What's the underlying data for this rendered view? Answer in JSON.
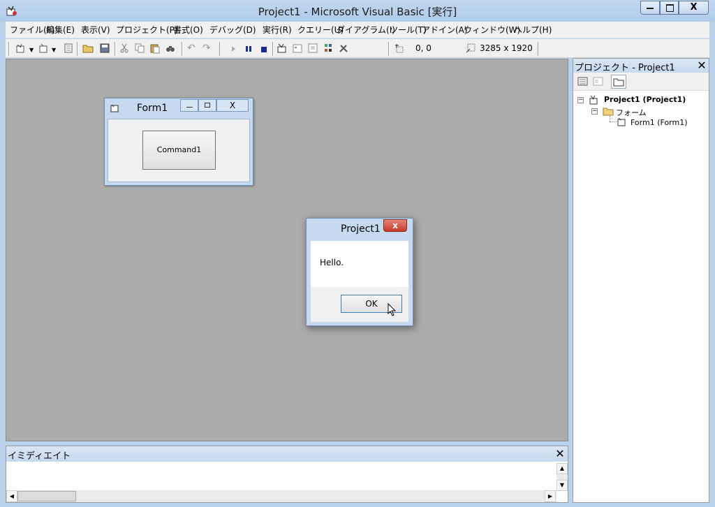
{
  "window": {
    "title": "Project1 - Microsoft Visual Basic [実行]",
    "minimize": "—",
    "maximize": "□",
    "close": "X"
  },
  "menu": [
    "ファイル(F)",
    "編集(E)",
    "表示(V)",
    "プロジェクト(P)",
    "書式(O)",
    "デバッグ(D)",
    "実行(R)",
    "クエリー(U)",
    "ダイアグラム(I)",
    "ツール(T)",
    "アドイン(A)",
    "ウィンドウ(W)",
    "ヘルプ(H)"
  ],
  "toolbar": {
    "position": "0, 0",
    "size": "3285 x 1920"
  },
  "project_panel": {
    "title": "プロジェクト - Project1",
    "close": "✕",
    "tree": {
      "project": "Project1 (Project1)",
      "forms_folder": "フォーム",
      "form": "Form1 (Form1)"
    }
  },
  "immediate": {
    "title": "イミディエイト",
    "close": "✕"
  },
  "form1": {
    "title": "Form1",
    "button": "Command1"
  },
  "msgbox": {
    "title": "Project1",
    "message": "Hello.",
    "ok": "OK",
    "close": "x"
  },
  "colors": {
    "mdi_background": "#ababab",
    "title_bar": "#b9d1ea",
    "close_red": "#c73a2a"
  }
}
